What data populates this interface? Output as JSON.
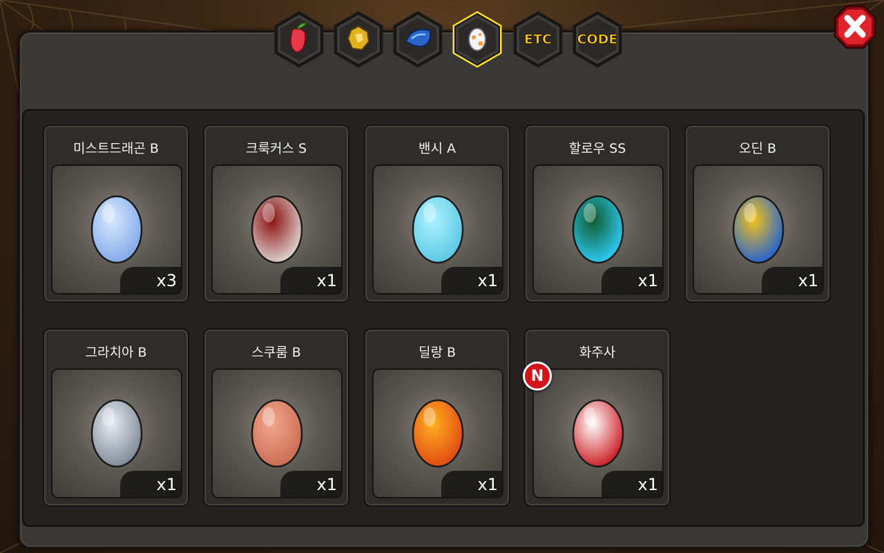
{
  "tabs": [
    {
      "icon": "fruit-icon",
      "label": ""
    },
    {
      "icon": "gold-ore-icon",
      "label": ""
    },
    {
      "icon": "blue-shell-icon",
      "label": ""
    },
    {
      "icon": "egg-icon",
      "label": "",
      "selected": true
    },
    {
      "icon": "etc-icon",
      "label": "ETC"
    },
    {
      "icon": "code-icon",
      "label": "CODE"
    }
  ],
  "close": {
    "icon": "close-icon"
  },
  "eggs": [
    {
      "name": "미스트드래곤 B",
      "count": "x3",
      "colors": [
        "#d8eaff",
        "#7fa6e8"
      ]
    },
    {
      "name": "크룩커스 S",
      "count": "x1",
      "colors": [
        "#8b0e0e",
        "#e0dcd8"
      ]
    },
    {
      "name": "밴시 A",
      "count": "x1",
      "colors": [
        "#aef2ff",
        "#58c6e2"
      ]
    },
    {
      "name": "할로우 SS",
      "count": "x1",
      "colors": [
        "#0e5a2a",
        "#2fd0ff"
      ]
    },
    {
      "name": "오딘 B",
      "count": "x1",
      "colors": [
        "#f5c21a",
        "#1b5fd8"
      ]
    },
    {
      "name": "그라치아 B",
      "count": "x1",
      "colors": [
        "#e6ecf2",
        "#7b8593"
      ]
    },
    {
      "name": "스쿠룸 B",
      "count": "x1",
      "colors": [
        "#f2a78e",
        "#c96a52"
      ]
    },
    {
      "name": "딜랑 B",
      "count": "x1",
      "colors": [
        "#ffb020",
        "#e04512"
      ]
    },
    {
      "name": "화주사",
      "count": "x1",
      "colors": [
        "#ffffff",
        "#c9161b"
      ],
      "new": true,
      "badge": "N"
    }
  ]
}
